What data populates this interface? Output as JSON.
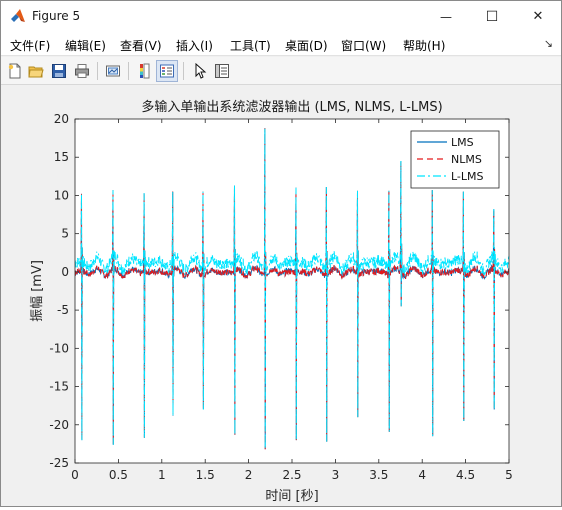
{
  "window": {
    "title": "Figure 5",
    "minimize_glyph": "—",
    "maximize_glyph": "☐",
    "close_glyph": "✕"
  },
  "menu": {
    "items": [
      "文件(F)",
      "编辑(E)",
      "查看(V)",
      "插入(I)",
      "工具(T)",
      "桌面(D)",
      "窗口(W)",
      "帮助(H)"
    ],
    "overflow_glyph": "↘"
  },
  "toolbar": {
    "buttons": [
      "new-figure-icon",
      "open-file-icon",
      "save-icon",
      "print-icon",
      "link-plot-icon",
      "colorbar-icon",
      "legend-icon",
      "edit-plot-pointer-icon",
      "property-inspector-icon"
    ]
  },
  "chart_data": {
    "type": "line",
    "title": "多输入单输出系统滤波器输出 (LMS, NLMS, L-LMS)",
    "xlabel": "时间 [秒]",
    "ylabel": "振幅 [mV]",
    "xlim": [
      0,
      5
    ],
    "ylim": [
      -25,
      20
    ],
    "xticks": [
      "0",
      "0.5",
      "1",
      "1.5",
      "2",
      "2.5",
      "3",
      "3.5",
      "4",
      "4.5",
      "5"
    ],
    "yticks": [
      "-25",
      "-20",
      "-15",
      "-10",
      "-5",
      "0",
      "5",
      "10",
      "15",
      "20"
    ],
    "grid": false,
    "legend_position": "top-right",
    "series": [
      {
        "name": "LMS",
        "color": "#0072bd",
        "style": "solid"
      },
      {
        "name": "NLMS",
        "color": "#e41a1c",
        "style": "dashed"
      },
      {
        "name": "L-LMS",
        "color": "#00e5ff",
        "style": "dashdot"
      }
    ],
    "spikes": [
      {
        "t": 0.08,
        "max": 10.2,
        "min": -22.0,
        "baseline": 1.0
      },
      {
        "t": 0.44,
        "max": 10.7,
        "min": -22.6,
        "baseline": 0.6
      },
      {
        "t": 0.8,
        "max": 10.3,
        "min": -21.7,
        "baseline": 0.6
      },
      {
        "t": 1.13,
        "max": 10.5,
        "min": -18.8,
        "baseline": 0.2
      },
      {
        "t": 1.48,
        "max": 10.5,
        "min": -18.0,
        "baseline": 0.2
      },
      {
        "t": 1.84,
        "max": 11.3,
        "min": -21.3,
        "baseline": 0.8
      },
      {
        "t": 2.19,
        "max": 18.8,
        "min": -23.2,
        "baseline": 0.4
      },
      {
        "t": 2.55,
        "max": 11.0,
        "min": -22.0,
        "baseline": 0.3
      },
      {
        "t": 2.9,
        "max": 11.1,
        "min": -22.2,
        "baseline": 0.5
      },
      {
        "t": 3.26,
        "max": 10.6,
        "min": -19.0,
        "baseline": 0.6
      },
      {
        "t": 3.62,
        "max": 10.6,
        "min": -20.9,
        "baseline": 0.8
      },
      {
        "t": 3.76,
        "max": 14.5,
        "min": -4.5,
        "baseline": 1.5
      },
      {
        "t": 4.12,
        "max": 10.7,
        "min": -21.5,
        "baseline": 0.6
      },
      {
        "t": 4.48,
        "max": 10.5,
        "min": -19.5,
        "baseline": 0.4
      },
      {
        "t": 4.83,
        "max": 8.2,
        "min": -18.0,
        "baseline": 1.0
      }
    ],
    "noise_baseline": {
      "LMS": 0.0,
      "NLMS": 0.0,
      "L-LMS": 1.2
    }
  }
}
